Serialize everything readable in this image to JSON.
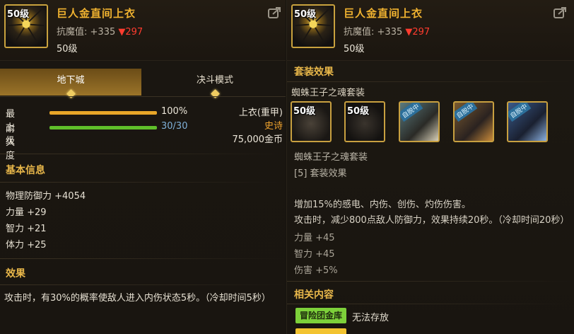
{
  "left": {
    "item": {
      "level_badge": "50级",
      "name": "巨人金直间上衣",
      "stat_label": "抗魔值:",
      "stat_value": "+335",
      "stat_drop": "▼297",
      "level": "50级"
    },
    "tabs": [
      {
        "label": "地下城",
        "active": true
      },
      {
        "label": "决斗模式",
        "active": false
      }
    ],
    "bars": [
      {
        "label": "最上级",
        "value": "100%",
        "fill": 1.0,
        "color": "#e8a628"
      },
      {
        "label": "耐久度",
        "value": "30/30",
        "fill": 1.0,
        "color": "#5fbf2a"
      }
    ],
    "type": {
      "category": "上衣(重甲)",
      "rarity": "史诗",
      "price": "75,000金币"
    },
    "basic_info_title": "基本信息",
    "stats": [
      "物理防御力 +4054",
      "力量 +29",
      "智力 +21",
      "体力 +25"
    ],
    "effect_title": "效果",
    "effect_text": "攻击时，有30%的概率使敌人进入内伤状态5秒。（冷却时间5秒）"
  },
  "right": {
    "item": {
      "level_badge": "50级",
      "name": "巨人金直间上衣",
      "stat_label": "抗魔值:",
      "stat_value": "+335",
      "stat_drop": "▼297",
      "level": "50级"
    },
    "set_effect_title": "套装效果",
    "set_name": "蜘蛛王子之魂套装",
    "set_icons": [
      {
        "level": "50级",
        "badge": ""
      },
      {
        "level": "50级",
        "badge": ""
      },
      {
        "level": "",
        "badge": "自脱中"
      },
      {
        "level": "",
        "badge": "自脱中"
      },
      {
        "level": "",
        "badge": "自脱中"
      }
    ],
    "set_name_2": "蜘蛛王子之魂套装",
    "set_piece_label": "[5] 套装效果",
    "effect_lines": [
      "增加15%的感电、内伤、创伤、灼伤伤害。",
      "攻击时，减少800点敌人防御力，效果持续20秒。（冷却时间20秒）"
    ],
    "bonus_stats": [
      "力量 +45",
      "智力 +45",
      "伤害 +5%"
    ],
    "related_title": "相关内容",
    "tag_label": "冒险团金库",
    "tag_desc": "无法存放"
  },
  "colors": {
    "accent_gold": "#e8b74a",
    "item_name": "#f1b330",
    "drop_red": "#ff3c2f",
    "epic_orange": "#f1a42e",
    "tag_green": "#7dd13a"
  }
}
